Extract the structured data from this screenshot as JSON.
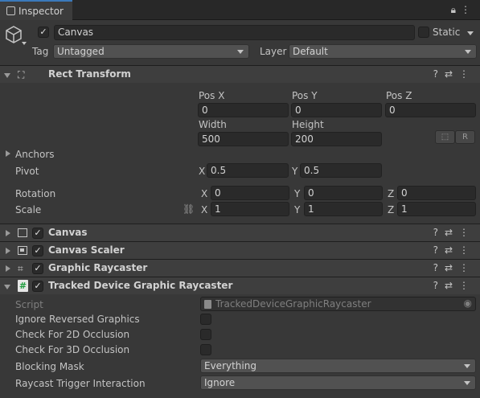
{
  "window": {
    "tab_title": "Inspector"
  },
  "object": {
    "name": "Canvas",
    "static_label": "Static",
    "tag_label": "Tag",
    "tag_value": "Untagged",
    "layer_label": "Layer",
    "layer_value": "Default"
  },
  "rect_transform": {
    "title": "Rect Transform",
    "pos_x_label": "Pos X",
    "pos_x": "0",
    "pos_y_label": "Pos Y",
    "pos_y": "0",
    "pos_z_label": "Pos Z",
    "pos_z": "0",
    "width_label": "Width",
    "width": "500",
    "height_label": "Height",
    "height": "200",
    "r_button": "R",
    "anchors_label": "Anchors",
    "pivot_label": "Pivot",
    "pivot_x": "0.5",
    "pivot_y": "0.5",
    "rotation_label": "Rotation",
    "rot_x": "0",
    "rot_y": "0",
    "rot_z": "0",
    "scale_label": "Scale",
    "scale_x": "1",
    "scale_y": "1",
    "scale_z": "1",
    "axis_x": "X",
    "axis_y": "Y",
    "axis_z": "Z"
  },
  "components": [
    {
      "title": "Canvas"
    },
    {
      "title": "Canvas Scaler"
    },
    {
      "title": "Graphic Raycaster"
    },
    {
      "title": "Tracked Device Graphic Raycaster"
    }
  ],
  "tracked": {
    "script_label": "Script",
    "script_value": "TrackedDeviceGraphicRaycaster",
    "ignore_reversed_label": "Ignore Reversed Graphics",
    "check_2d_label": "Check For 2D Occlusion",
    "check_3d_label": "Check For 3D Occlusion",
    "blocking_mask_label": "Blocking Mask",
    "blocking_mask_value": "Everything",
    "raycast_trigger_label": "Raycast Trigger Interaction",
    "raycast_trigger_value": "Ignore"
  },
  "icons": {
    "lock": "lock-icon",
    "menu": "kebab-menu-icon",
    "help": "help-icon",
    "presets": "presets-icon"
  }
}
